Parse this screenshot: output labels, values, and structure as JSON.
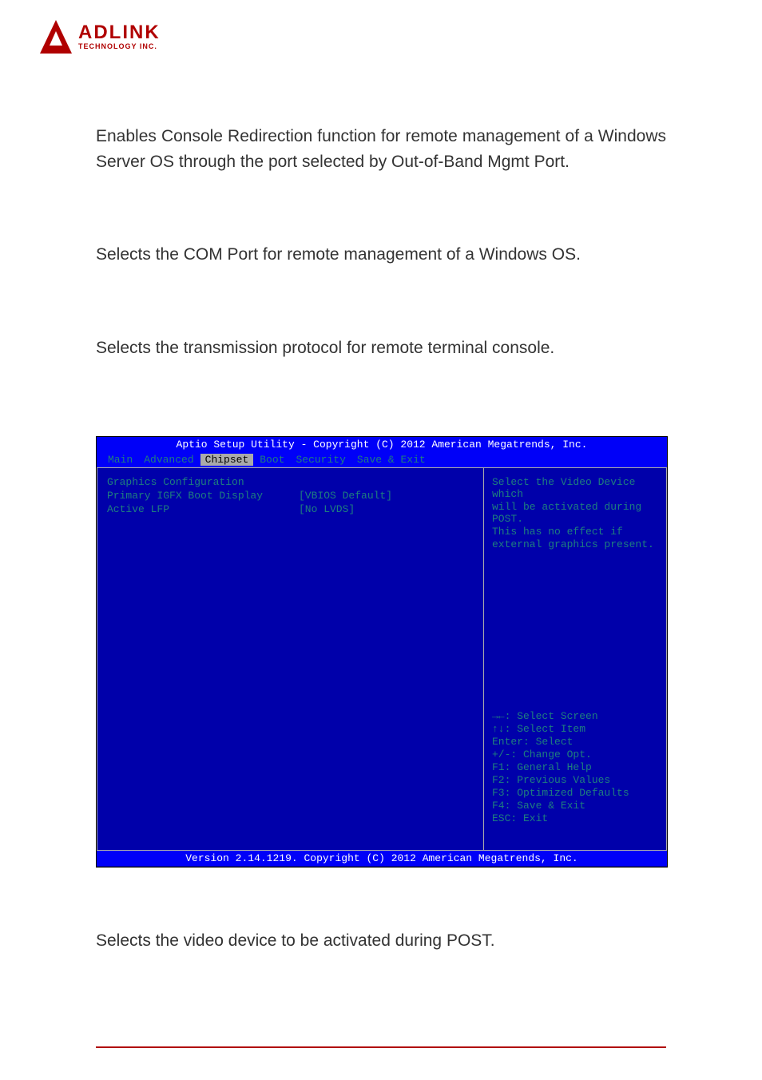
{
  "logo": {
    "main": "ADLINK",
    "sub": "TECHNOLOGY INC."
  },
  "paragraphs": {
    "p1": "Enables Console Redirection function for remote management of a Windows Server OS through the port selected by Out-of-Band Mgmt Port.",
    "p2": "Selects the COM Port for remote management of a Windows OS.",
    "p3": "Selects the transmission protocol for remote terminal console.",
    "p4": "Selects the video device to be activated during POST."
  },
  "bios": {
    "header": "Aptio Setup Utility - Copyright (C) 2012 American Megatrends, Inc.",
    "footer": "Version 2.14.1219. Copyright (C) 2012 American Megatrends, Inc.",
    "tabs": [
      "Main",
      "Advanced",
      "Chipset",
      "Boot",
      "Security",
      "Save & Exit"
    ],
    "active_tab": "Chipset",
    "rows": [
      {
        "label": "Graphics Configuration",
        "value": ""
      },
      {
        "label": "Primary IGFX Boot Display",
        "value": "[VBIOS Default]"
      },
      {
        "label": "Active LFP",
        "value": "[No LVDS]"
      }
    ],
    "help_description": [
      "Select the Video Device which",
      "will be activated during POST.",
      " This has no effect if",
      "external graphics present."
    ],
    "help_keys": [
      "→←: Select Screen",
      "↑↓: Select Item",
      "Enter: Select",
      "+/-: Change Opt.",
      "F1: General Help",
      "F2: Previous Values",
      "F3: Optimized Defaults",
      "F4: Save & Exit",
      "ESC: Exit"
    ]
  }
}
